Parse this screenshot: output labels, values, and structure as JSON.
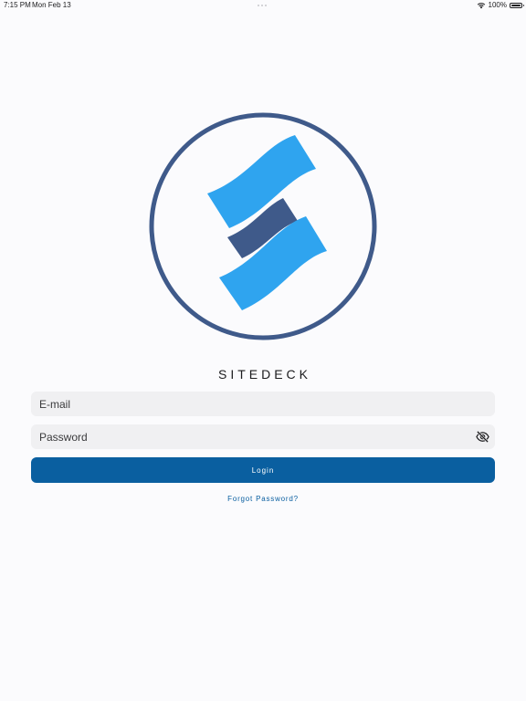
{
  "status_bar": {
    "time": "7:15 PM",
    "date": "Mon Feb 13",
    "battery": "100%",
    "icons": [
      "wifi-icon",
      "battery-icon"
    ]
  },
  "logo": {
    "icon": "sitedeck-logo",
    "colors": {
      "ring": "#3f5a8a",
      "light_blue": "#2fa4ef",
      "dark_blue": "#3f5a8a"
    }
  },
  "app_name": "SITEDECK",
  "login_form": {
    "email_placeholder": "E-mail",
    "email_value": "",
    "password_placeholder": "Password",
    "password_value": "",
    "password_toggle_icon": "eye-slash-icon",
    "login_label": "Login",
    "forgot_password_label": "Forgot Password?"
  },
  "colors": {
    "accent": "#0a5fa0",
    "background": "#fbfbfd",
    "field_background": "#f0f0f2"
  }
}
